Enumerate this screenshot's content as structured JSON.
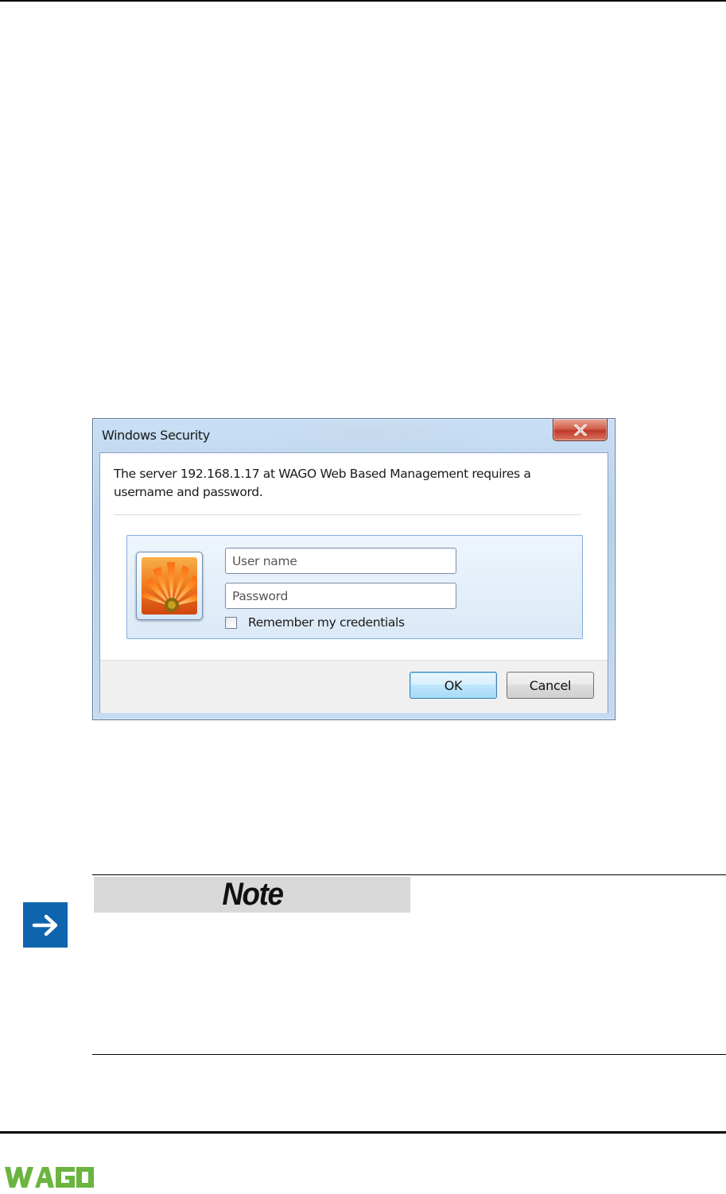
{
  "dialog": {
    "title": "Windows Security",
    "message_line1": "The server 192.168.1.17 at WAGO Web Based Management requires a",
    "message_line2": "username and password.",
    "username_placeholder": "User name",
    "password_placeholder": "Password",
    "remember_label": "Remember my credentials",
    "ok_label": "OK",
    "cancel_label": "Cancel",
    "close_icon": "close-x-icon"
  },
  "note": {
    "title": "Note",
    "icon": "arrow-right-icon",
    "accent_color": "#0f64ae"
  },
  "footer": {
    "logo_text": "WAGO",
    "logo_color": "#6bb43f"
  }
}
